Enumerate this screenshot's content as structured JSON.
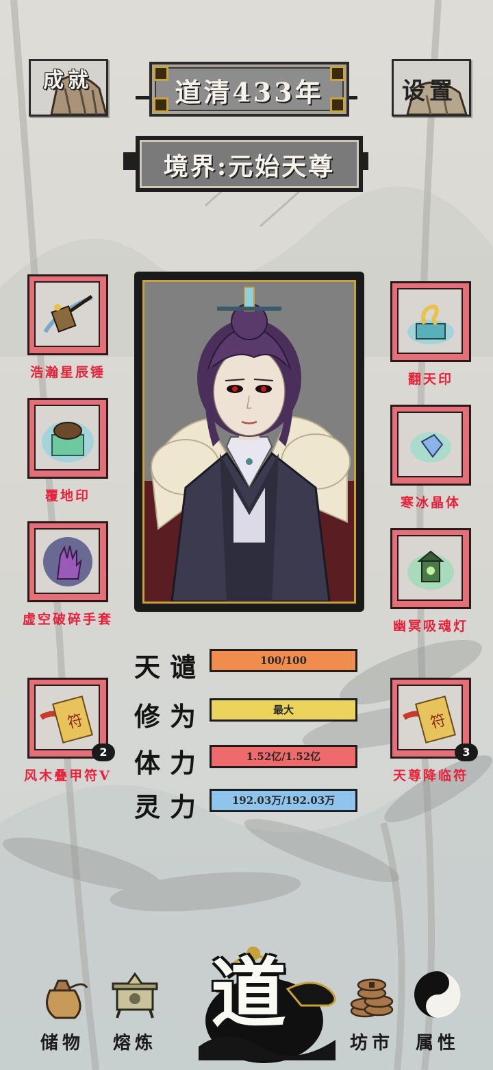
{
  "header": {
    "achievements_label": "成就",
    "settings_label": "设置",
    "year": "道清433年",
    "realm": "境界:元始天尊"
  },
  "equipment": {
    "left": [
      {
        "name": "浩瀚星辰锤",
        "icon": "star-hammer-icon"
      },
      {
        "name": "覆地印",
        "icon": "earth-seal-icon"
      },
      {
        "name": "虚空破碎手套",
        "icon": "void-gauntlet-icon"
      },
      {
        "name": "风木叠甲符V",
        "icon": "talisman-scroll-icon",
        "count": "2"
      }
    ],
    "right": [
      {
        "name": "翻天印",
        "icon": "heaven-seal-icon"
      },
      {
        "name": "寒冰晶体",
        "icon": "ice-crystal-icon"
      },
      {
        "name": "幽冥吸魂灯",
        "icon": "soul-lantern-icon"
      },
      {
        "name": "天尊降临符",
        "icon": "talisman-scroll-icon",
        "count": "3"
      }
    ]
  },
  "stats": [
    {
      "label": "天谴",
      "value": "100/100",
      "fill": 1.0,
      "color": "#f08c4e"
    },
    {
      "label": "修为",
      "value": "最大",
      "fill": 1.0,
      "color": "#ecd45c"
    },
    {
      "label": "体力",
      "value": "1.52亿/1.52亿",
      "fill": 1.0,
      "color": "#ef6a6a"
    },
    {
      "label": "灵力",
      "value": "192.03万/192.03万",
      "fill": 1.0,
      "color": "#8fc4ec"
    }
  ],
  "nav": {
    "storage": "储物",
    "refine": "熔炼",
    "dao": "道",
    "market": "坊市",
    "attributes": "属性"
  }
}
